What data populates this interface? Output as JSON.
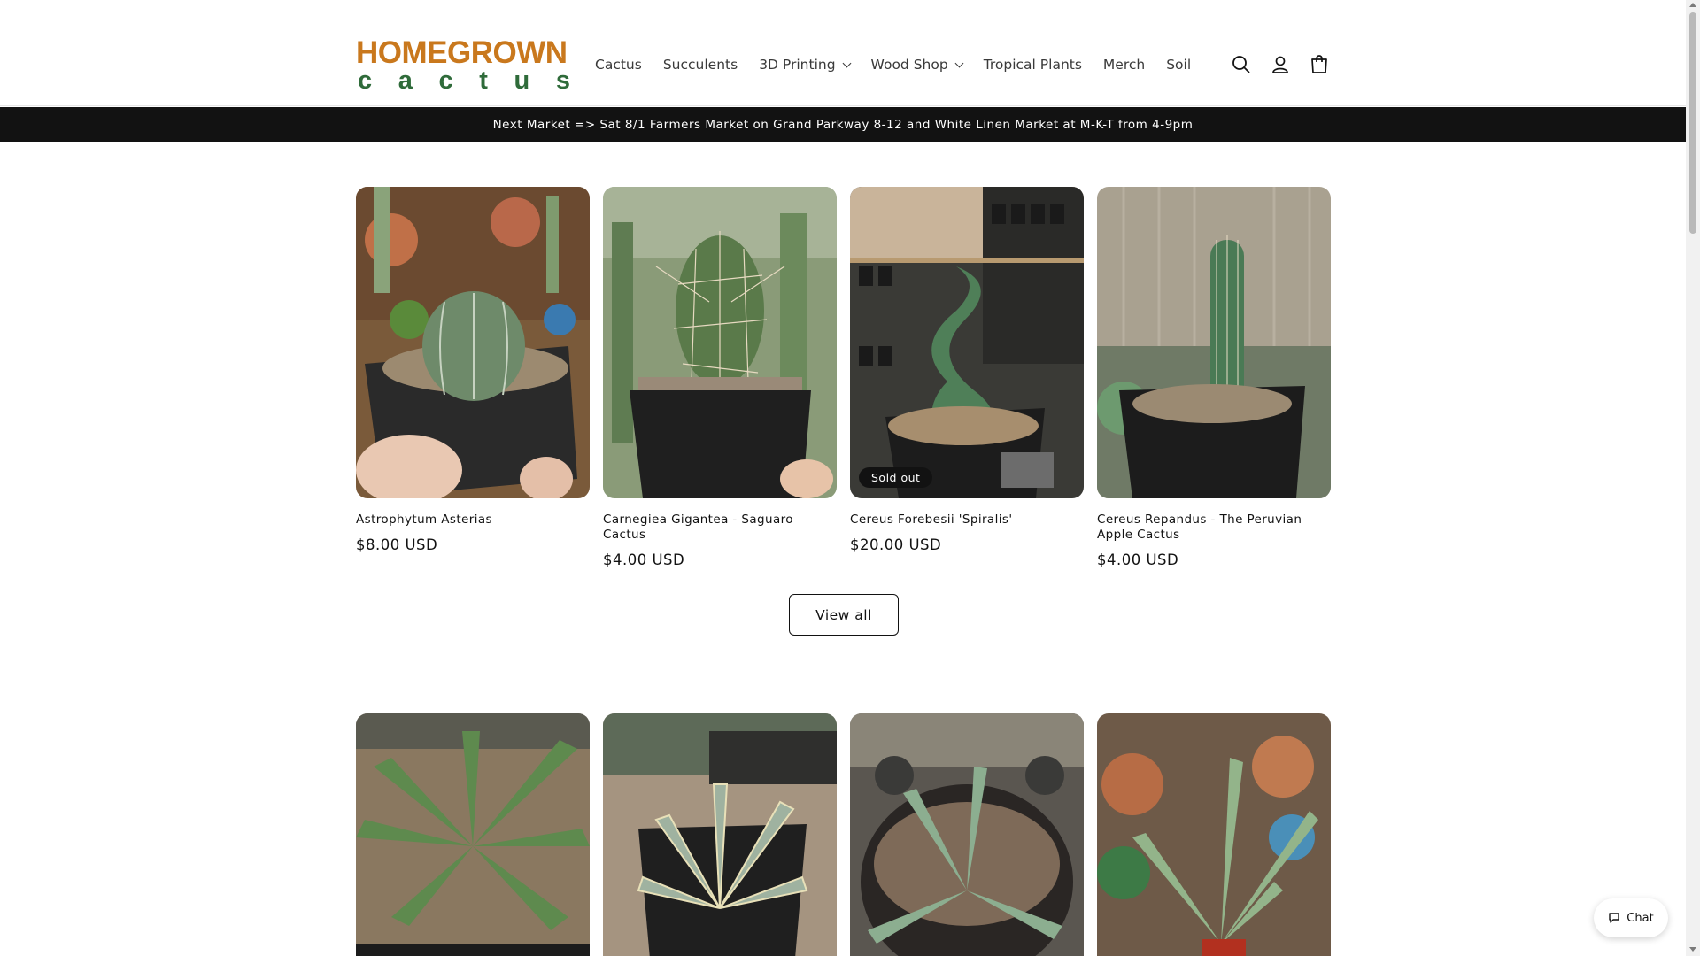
{
  "brand": {
    "logo_line1": "HOMEGROWN",
    "logo_line2": [
      "c",
      "a",
      "c",
      "t",
      "u",
      "s"
    ],
    "colors": {
      "logo_top": "#c9781d",
      "logo_bottom": "#2f6b3a"
    }
  },
  "nav": {
    "items": [
      {
        "label": "Cactus",
        "dropdown": false
      },
      {
        "label": "Succulents",
        "dropdown": false
      },
      {
        "label": "3D Printing",
        "dropdown": true
      },
      {
        "label": "Wood Shop",
        "dropdown": true
      },
      {
        "label": "Tropical Plants",
        "dropdown": false
      },
      {
        "label": "Merch",
        "dropdown": false
      },
      {
        "label": "Soil",
        "dropdown": false
      }
    ],
    "icons": [
      "search-icon",
      "account-icon",
      "cart-icon"
    ]
  },
  "announcement": {
    "text": "Next Market => Sat 8/1 Farmers Market on Grand Parkway 8-12 and White Linen Market at M-K-T from 4-9pm"
  },
  "products": [
    {
      "title": "Astrophytum Asterias",
      "price": "$8.00 USD",
      "sold_out": false
    },
    {
      "title": "Carnegiea Gigantea - Saguaro Cactus",
      "price": "$4.00 USD",
      "sold_out": false
    },
    {
      "title": "Cereus Forebesii 'Spiralis'",
      "price": "$20.00 USD",
      "sold_out": true,
      "badge": "Sold out"
    },
    {
      "title": "Cereus Repandus - The Peruvian Apple Cactus",
      "price": "$4.00 USD",
      "sold_out": false
    }
  ],
  "view_all_label": "View all",
  "chat": {
    "label": "Chat"
  }
}
